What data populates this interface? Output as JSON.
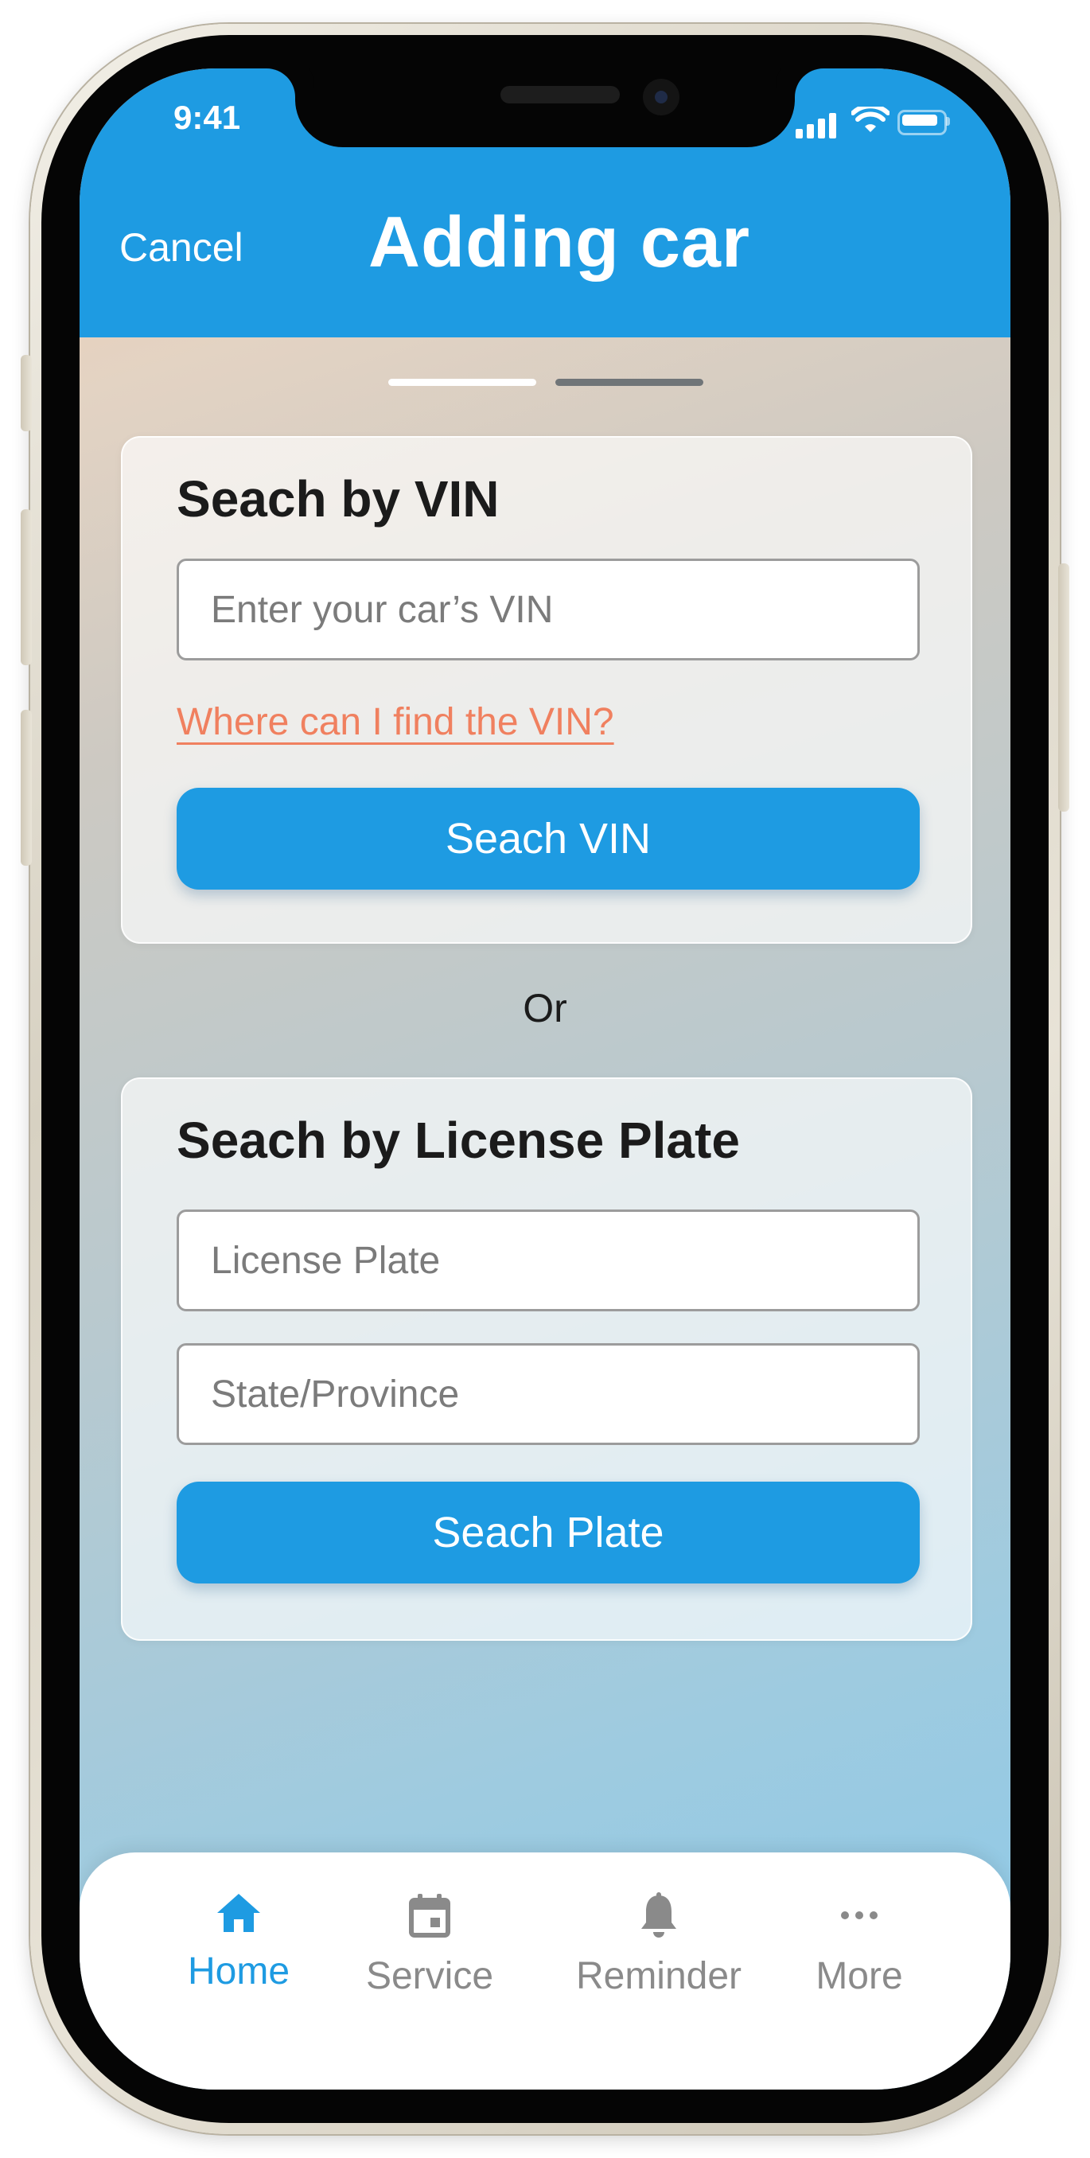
{
  "status_bar": {
    "time": "9:41"
  },
  "header": {
    "cancel_label": "Cancel",
    "title": "Adding car"
  },
  "pager": {
    "pages": 2,
    "active_index": 0
  },
  "vin_section": {
    "title": "Seach by VIN",
    "input_placeholder": "Enter your car’s VIN",
    "help_link": "Where can I find the VIN?",
    "button_label": "Seach VIN"
  },
  "separator_text": "Or",
  "plate_section": {
    "title": "Seach by License Plate",
    "plate_placeholder": "License Plate",
    "state_placeholder": "State/Province",
    "button_label": "Seach Plate"
  },
  "tab_bar": {
    "items": [
      {
        "label": "Home",
        "icon": "home-icon",
        "active": true
      },
      {
        "label": "Service",
        "icon": "calendar-icon",
        "active": false
      },
      {
        "label": "Reminder",
        "icon": "bell-icon",
        "active": false
      },
      {
        "label": "More",
        "icon": "more-dots-icon",
        "active": false
      }
    ]
  },
  "colors": {
    "primary": "#1e9be2",
    "link": "#f0805f",
    "inactive_tab": "#8a8a8a"
  }
}
